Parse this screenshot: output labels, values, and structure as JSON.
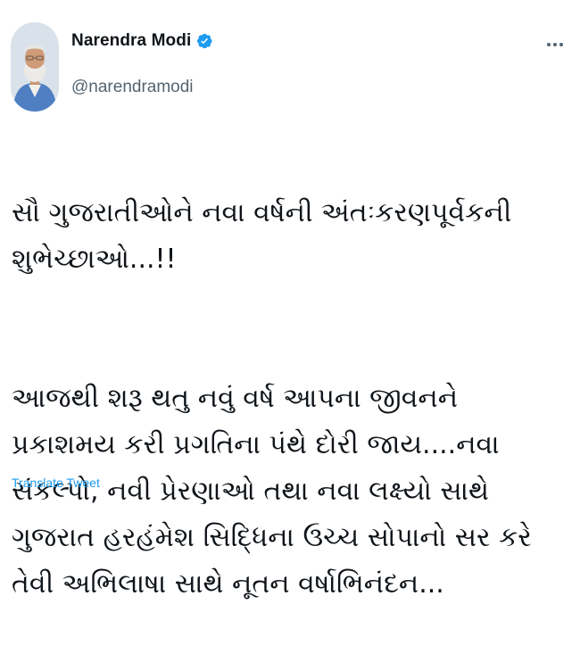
{
  "author": {
    "display_name": "Narendra Modi",
    "handle": "@narendramodi",
    "verified": true,
    "avatar_icon": "profile-photo"
  },
  "menu": {
    "more_icon": "more-horizontal-icon"
  },
  "tweet": {
    "line1": "સૌ ગુજરાતીઓને નવા વર્ષની અંતઃકરણપૂર્વકની શુભેચ્છાઓ...!!",
    "paragraph2": "આજથી શરૂ થતુ નવું વર્ષ આપના જીવનને પ્રકાશમય કરી પ્રગતિના પંથે દોરી જાય....નવા સંકલ્પો, નવી પ્રેરણાઓ તથા નવા લક્ષ્યો સાથે ગુજરાત હરહંમેશ સિદ્ધિના ઉચ્ચ  સોપાનો સર કરે તેવી અભિલાષા સાથે નૂતન વર્ષાભિનંદન..."
  },
  "actions": {
    "translate_label": "Translate Tweet"
  },
  "colors": {
    "text": "#0f1419",
    "secondary_text": "#536471",
    "verified_blue": "#1d9bf0",
    "link_blue": "#1d9bf0"
  }
}
